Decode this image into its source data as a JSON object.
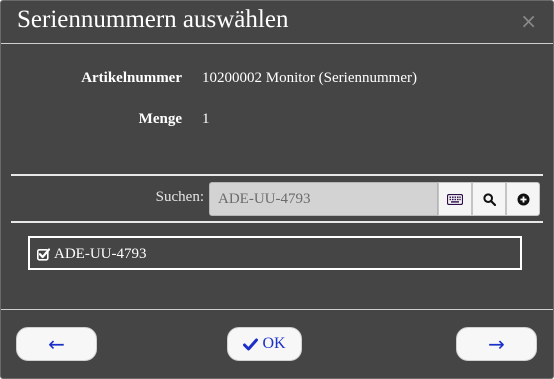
{
  "dialog": {
    "title": "Seriennummern auswählen",
    "close_glyph": "×"
  },
  "article": {
    "number_label": "Artikelnummer",
    "number_value": "10200002 Monitor (Seriennummer)",
    "quantity_label": "Menge",
    "quantity_value": "1"
  },
  "search": {
    "label": "Suchen:",
    "value": "ADE-UU-4793",
    "buttons": [
      "keyboard-icon",
      "search-icon",
      "add-icon"
    ]
  },
  "serials": [
    {
      "label": "ADE-UU-4793",
      "checked": true
    }
  ],
  "footer": {
    "prev_glyph": "←",
    "ok_label": "OK",
    "next_glyph": "→"
  },
  "colors": {
    "background": "#454545",
    "accent": "#1b30c8"
  }
}
